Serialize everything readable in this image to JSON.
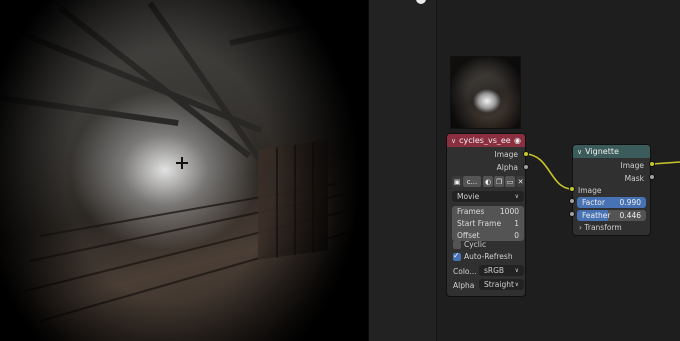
{
  "image_node": {
    "title": "cycles_vs_eeve...",
    "header_color": "#8a2f3f",
    "outputs": {
      "image": "Image",
      "alpha": "Alpha"
    },
    "image_short": "c...",
    "source": "Movie",
    "frames_label": "Frames",
    "frames_value": "1000",
    "start_frame_label": "Start Frame",
    "start_frame_value": "1",
    "offset_label": "Offset",
    "offset_value": "0",
    "cyclic_label": "Cyclic",
    "cyclic_checked": false,
    "auto_refresh_label": "Auto-Refresh",
    "auto_refresh_checked": true,
    "color_label": "Colo...",
    "color_value": "sRGB",
    "alpha_label": "Alpha",
    "alpha_value": "Straight"
  },
  "vignette_node": {
    "title": "Vignette",
    "header_color": "#3c5b5b",
    "outputs": {
      "image": "Image",
      "mask": "Mask"
    },
    "input_image": "Image",
    "factor_label": "Factor",
    "factor_value": "0.990",
    "feather_label": "Feather",
    "feather_value": "0.446",
    "transform_label": "Transform"
  },
  "colors": {
    "socket_image": "#c7c729",
    "socket_value": "#a1a1a1",
    "accent": "#4772b3"
  }
}
